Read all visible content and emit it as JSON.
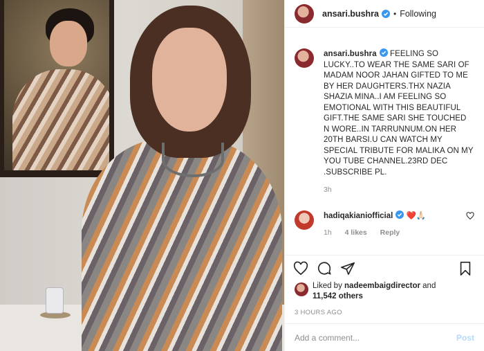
{
  "photo": {
    "alt": ""
  },
  "header": {
    "username": "ansari.bushra",
    "dot": "•",
    "follow_status": "Following",
    "verified_icon": "verified-badge-icon"
  },
  "caption": {
    "username": "ansari.bushra",
    "text": "FEELING SO LUCKY..TO WEAR THE SAME SARI OF MADAM NOOR JAHAN GIFTED TO ME BY HER DAUGHTERS.THX NAZIA SHAZIA MINA..I AM FEELING SO EMOTIONAL WITH THIS BEAUTIFUL GIFT.THE SAME SARI SHE TOUCHED N WORE..IN TARRUNNUM.ON HER 20TH BARSI.U CAN WATCH MY SPECIAL TRIBUTE FOR MALIKA ON MY YOU TUBE CHANNEL.23RD DEC .SUBSCRIBE PL.",
    "time": "3h"
  },
  "reply": {
    "username": "hadiqakianiofficial",
    "text": "❤️🙏🏻",
    "time": "1h",
    "likes": "4 likes",
    "reply_label": "Reply"
  },
  "actions": {
    "like_icon": "heart-icon",
    "comment_icon": "comment-icon",
    "share_icon": "share-icon",
    "save_icon": "bookmark-icon"
  },
  "likes": {
    "prefix": "Liked by ",
    "user": "nadeembaigdirector",
    "and": " and",
    "count": "11,542 others"
  },
  "posted": "3 HOURS AGO",
  "add_comment": {
    "placeholder": "Add a comment...",
    "post_label": "Post"
  },
  "colors": {
    "accent_link": "#b3dbff",
    "verified": "#3897f0",
    "muted": "#8e8e8e"
  }
}
